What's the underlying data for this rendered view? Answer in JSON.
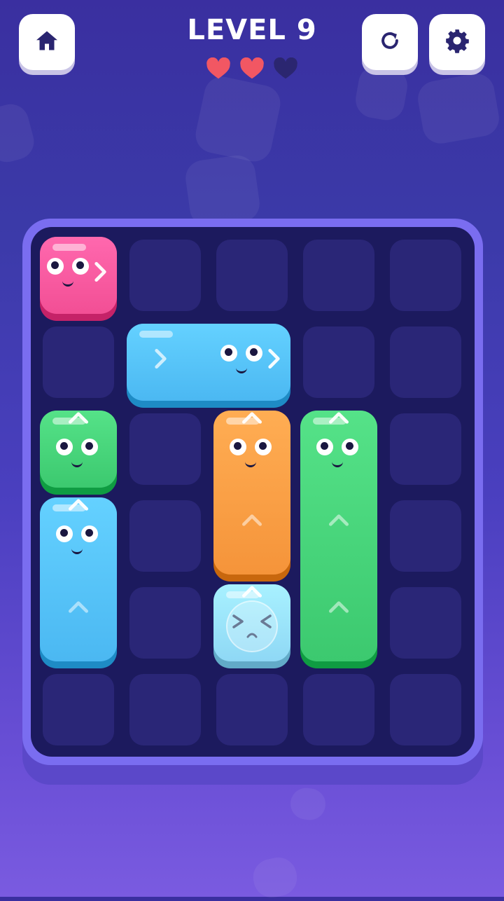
{
  "header": {
    "title": "LEVEL 9",
    "hearts_total": 3,
    "hearts_filled": 2
  },
  "icons": {
    "home": "home-icon",
    "restart": "restart-icon",
    "settings": "gear-icon",
    "heart": "heart-icon"
  },
  "board": {
    "columns": 5,
    "rows": 6,
    "blocks": [
      {
        "name": "pink-block",
        "color": "#f24f95",
        "col": 0,
        "row": 0,
        "w": 1,
        "h": 1,
        "direction": "right",
        "mood": "happy"
      },
      {
        "name": "blue-horizontal-block",
        "color": "#4bb8f2",
        "col": 1,
        "row": 1,
        "w": 2,
        "h": 1,
        "direction": "right",
        "mood": "happy"
      },
      {
        "name": "green-small-block",
        "color": "#3cc96f",
        "col": 0,
        "row": 2,
        "w": 1,
        "h": 1,
        "direction": "up",
        "mood": "happy"
      },
      {
        "name": "orange-block",
        "color": "#f5943a",
        "col": 2,
        "row": 2,
        "w": 1,
        "h": 2,
        "direction": "up",
        "mood": "happy"
      },
      {
        "name": "green-tall-block",
        "color": "#3cc96f",
        "col": 3,
        "row": 2,
        "w": 1,
        "h": 3,
        "direction": "up",
        "mood": "happy"
      },
      {
        "name": "blue-vertical-block",
        "color": "#4bb8f2",
        "col": 0,
        "row": 3,
        "w": 1,
        "h": 2,
        "direction": "up",
        "mood": "happy"
      },
      {
        "name": "frozen-block",
        "color": "#8fd8f5",
        "col": 2,
        "row": 4,
        "w": 1,
        "h": 1,
        "direction": "up",
        "mood": "sad"
      }
    ]
  },
  "colors": {
    "background_top": "#3a2fa0",
    "background_bottom": "#7a5be0",
    "heart_filled": "#f25763",
    "heart_empty": "#2b2670",
    "board_frame": "#7a6df0",
    "board_cell": "#2a2677"
  }
}
